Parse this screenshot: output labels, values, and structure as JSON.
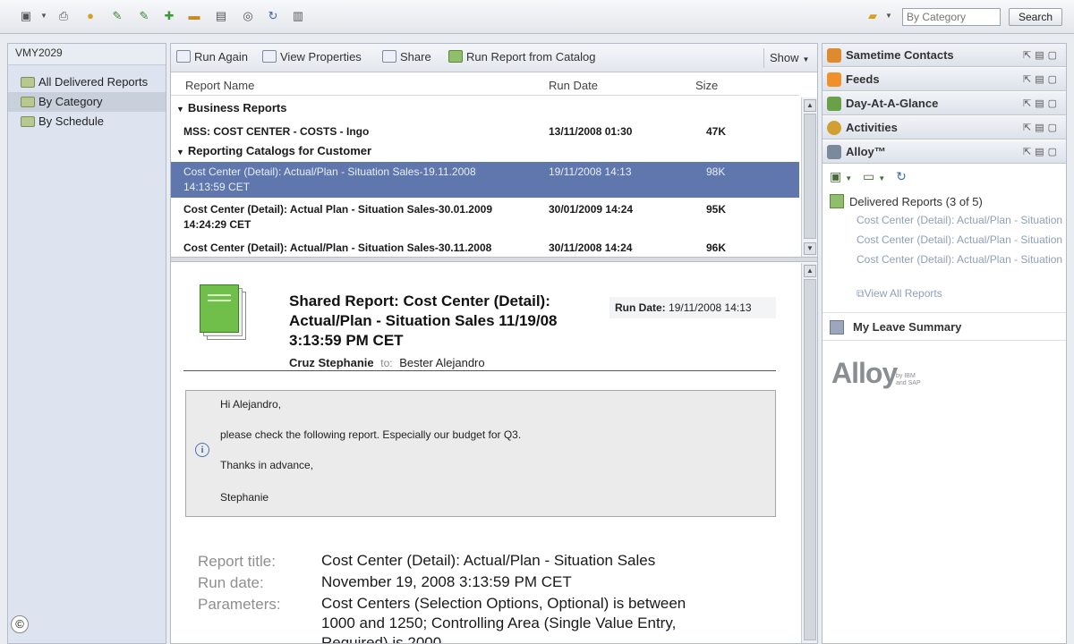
{
  "toolbar": {
    "search_placeholder": "By Category",
    "search_button": "Search"
  },
  "leftnav": {
    "title": "VMY2029",
    "items": [
      {
        "label": "All Delivered Reports"
      },
      {
        "label": "By Category"
      },
      {
        "label": "By Schedule"
      }
    ]
  },
  "actions": {
    "run_again": "Run Again",
    "view_properties": "View Properties",
    "share": "Share",
    "run_report_from_catalog": "Run Report from Catalog",
    "show": "Show"
  },
  "table": {
    "columns": [
      "Report Name",
      "Run Date",
      "Size"
    ],
    "groups": [
      "Business Reports",
      "Reporting Catalogs for Customer"
    ],
    "rows": [
      {
        "name": "MSS: COST CENTER - COSTS - Ingo",
        "date": "13/11/2008 01:30",
        "size": "47K"
      },
      {
        "name_line1": "Cost Center (Detail): Actual/Plan - Situation Sales-19.11.2008",
        "name_line2": "14:13:59 CET",
        "date": "19/11/2008 14:13",
        "size": "98K"
      },
      {
        "name_line1": "Cost Center (Detail): Actual Plan - Situation Sales-30.01.2009",
        "name_line2": "14:24:29 CET",
        "date": "30/01/2009 14:24",
        "size": "95K"
      },
      {
        "name": "Cost Center (Detail): Actual/Plan - Situation Sales-30.11.2008",
        "date": "30/11/2008 14:24",
        "size": "96K"
      }
    ]
  },
  "detail": {
    "title_line1": "Shared Report: Cost Center (Detail):",
    "title_line2": "Actual/Plan - Situation Sales 11/19/08",
    "title_line3": "3:13:59 PM CET",
    "from": "Cruz Stephanie",
    "to_label": "to:",
    "to": "Bester Alejandro",
    "run_date_label": "Run Date:",
    "run_date": "19/11/2008 14:13",
    "message": {
      "greeting": "Hi Alejandro,",
      "body": "please check the following report. Especially our budget for Q3.",
      "thanks": "Thanks in advance,",
      "signature": "Stephanie"
    },
    "meta": {
      "report_title_label": "Report title:",
      "report_title": "Cost Center (Detail): Actual/Plan - Situation Sales",
      "run_date_label": "Run date:",
      "run_date": "November 19, 2008 3:13:59 PM CET",
      "parameters_label": "Parameters:",
      "parameters_line1": "Cost Centers (Selection Options, Optional) is between",
      "parameters_line2": "1000 and 1250; Controlling Area (Single Value Entry,",
      "parameters_line3": "Required) is 2000"
    }
  },
  "sidebar": {
    "shelves": [
      "Sametime Contacts",
      "Feeds",
      "Day-At-A-Glance",
      "Activities",
      "Alloy™"
    ],
    "delivered_header": "Delivered Reports",
    "delivered_count": "(3 of 5)",
    "delivered_items": [
      "Cost Center (Detail): Actual/Plan - Situation Sales",
      "Cost Center (Detail): Actual/Plan - Situation Sales",
      "Cost Center (Detail): Actual/Plan - Situation Sales"
    ],
    "view_all": "View All Reports",
    "leave_summary": "My Leave Summary",
    "logo_text": "Alloy",
    "logo_sub_line1": "by IBM",
    "logo_sub_line2": "and SAP"
  },
  "copyright_symbol": "©",
  "colors": {
    "selection": "#5f77ad",
    "nav_bg": "#dde4f0",
    "folder_green": "#6fbf4a",
    "link_muted": "#8fa0b8"
  }
}
